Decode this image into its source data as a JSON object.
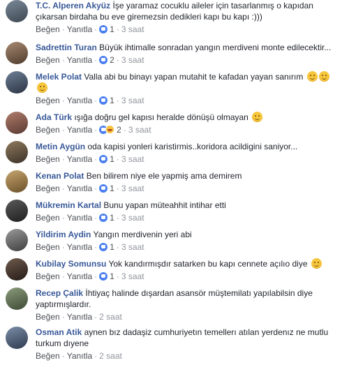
{
  "action_labels": {
    "like": "Beğen",
    "reply": "Yanıtla"
  },
  "comments": [
    {
      "name": "T.C. Alperen Akyüz",
      "text": "İşe yaramaz cocuklu aileler için tasarlanmış o kapıdan çıkarsan birdaha bu eve giremezsin dedikleri kapı bu kapı :)))",
      "reactions": "1",
      "time": "3 saat"
    },
    {
      "name": "Sadrettin Turan",
      "text": "Büyük ihtimalle sonradan yangın merdiveni monte edilecektir...",
      "reactions": "2",
      "time": "3 saat"
    },
    {
      "name": "Melek Polat",
      "text": "Valla abi bu binayı yapan mutahit te kafadan yayan sanırım",
      "reactions": "1",
      "time": "3 saat"
    },
    {
      "name": "Ada Türk",
      "text": "ışığa doğru gel kapısı heralde dönüşü olmayan",
      "reactions": "2",
      "time": "3 saat"
    },
    {
      "name": "Metin Aygün",
      "text": "oda kapisi yonleri karistirmis..koridora acildigini saniyor...",
      "reactions": "1",
      "time": "3 saat"
    },
    {
      "name": "Kenan Polat",
      "text": "Ben bilirem niye ele yapmiş ama demirem",
      "reactions": "1",
      "time": "3 saat"
    },
    {
      "name": "Mükremin Kartal",
      "text": "Bunu yapan müteahhit intihar etti",
      "reactions": "1",
      "time": "3 saat"
    },
    {
      "name": "Yildirim Aydin",
      "text": "Yangın merdivenin yeri abi",
      "reactions": "1",
      "time": "3 saat"
    },
    {
      "name": "Kubilay Somunsu",
      "text": "Yok kandırmışdır satarken bu kapı cennete açılıo diye",
      "reactions": "1",
      "time": "3 saat"
    },
    {
      "name": "Recep Çalik",
      "text": "İhtiyaç halinde dışardan asansör müştemilatı yapılabilsin diye yaptırmışlardır.",
      "time": "2 saat"
    },
    {
      "name": "Osman Atik",
      "text": "aynen bız dadaşiz cumhuriyetın temellerı atılan yerdenız ne mutlu turkum dıyene",
      "time": "2 saat"
    }
  ]
}
